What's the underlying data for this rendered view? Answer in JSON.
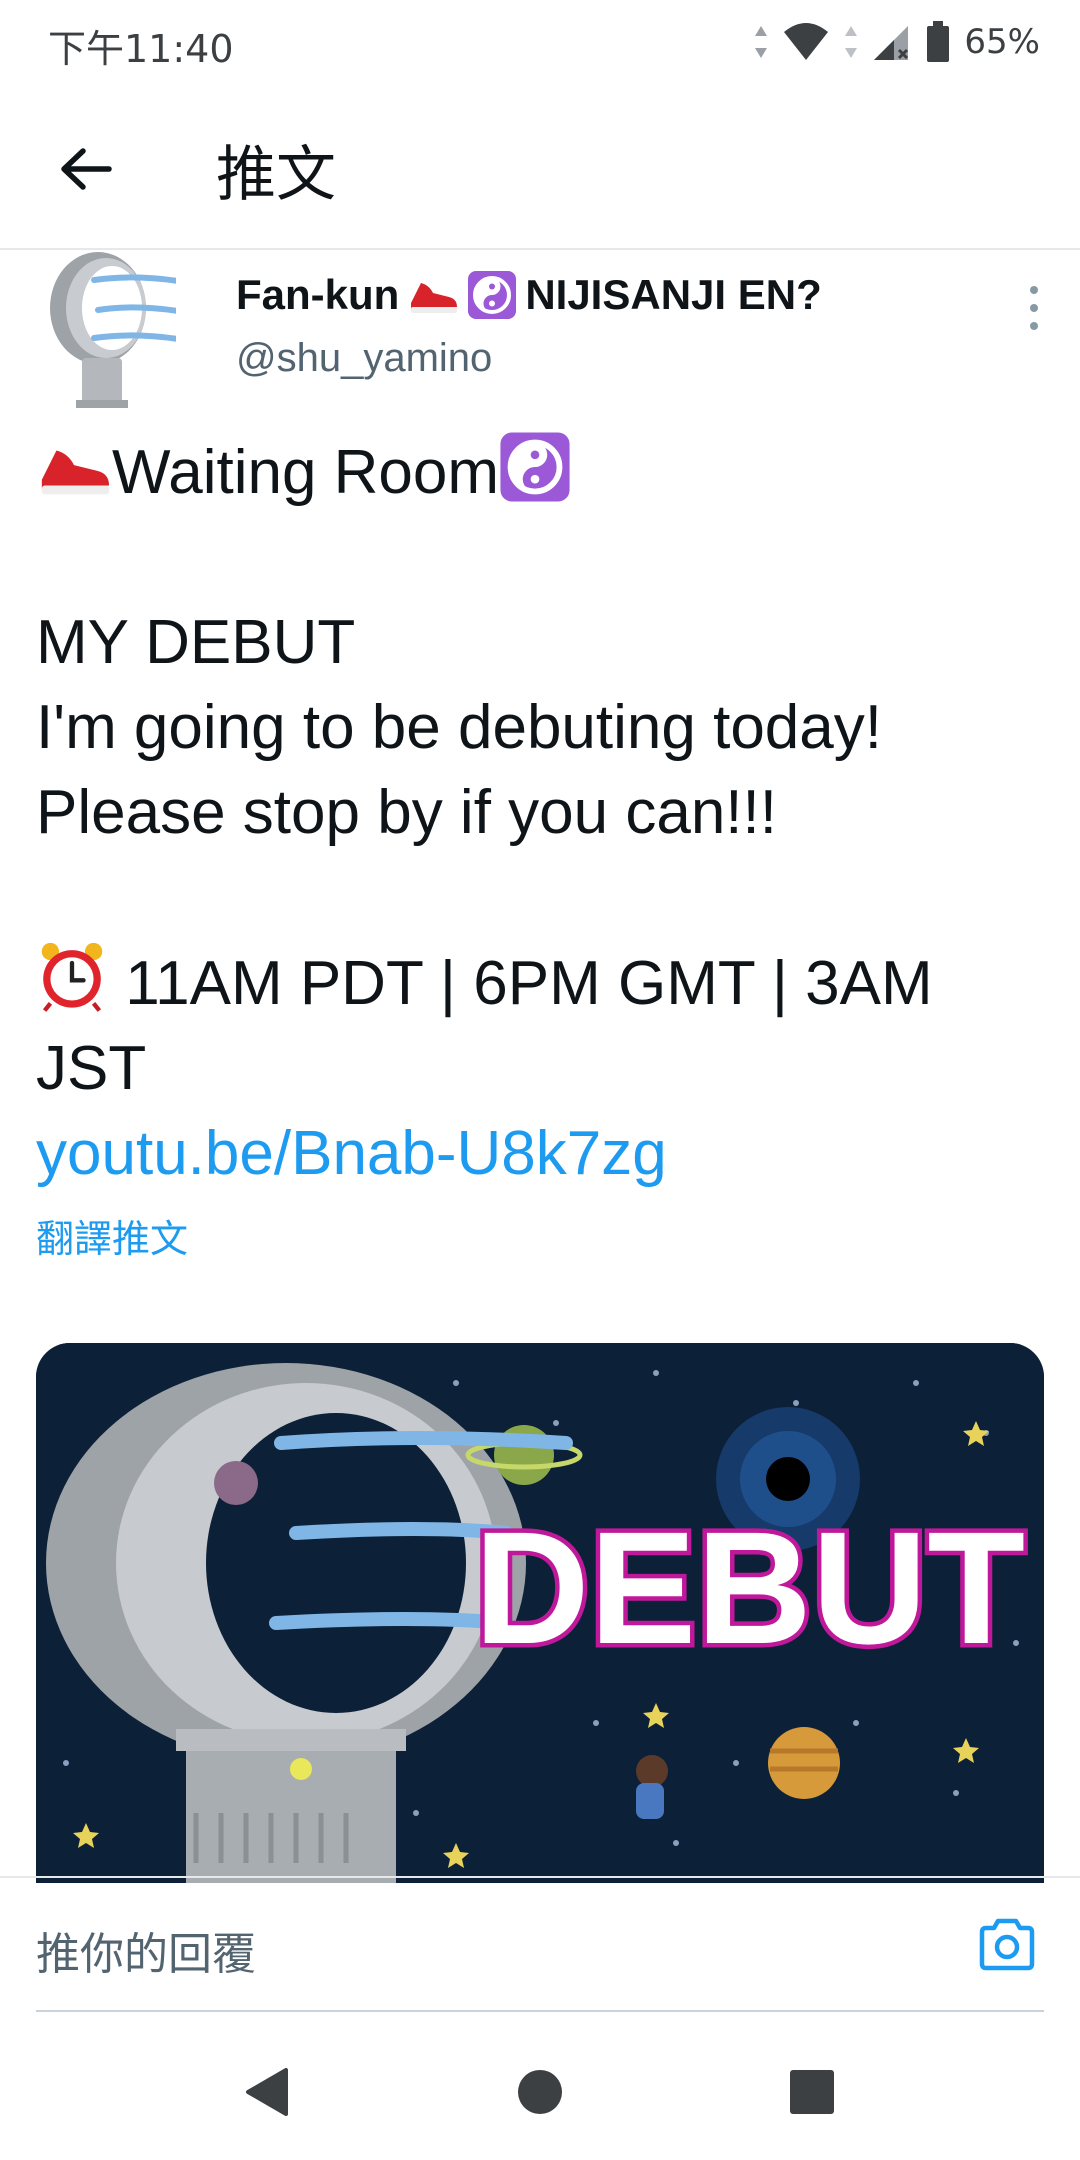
{
  "status_bar": {
    "time": "下午11:40",
    "battery": "65%"
  },
  "header": {
    "title": "推文"
  },
  "tweet": {
    "display_name": "Fan-kun",
    "display_name_suffix": "NIJISANJI EN?",
    "handle": "@shu_yamino",
    "lines": {
      "title": "Waiting Room",
      "debut": "MY DEBUT",
      "today": "I'm going to be debuting today!",
      "stop": "Please stop by if you can!!!",
      "time1": "11AM PDT | 6PM GMT | 3AM",
      "time2": "JST",
      "link": "youtu.be/Bnab-U8k7zg"
    },
    "translate_label": "翻譯推文",
    "media_text": "DEBUT"
  },
  "reply": {
    "placeholder": "推你的回覆"
  },
  "icons": {
    "back": "arrow-left-icon",
    "more": "more-vertical-icon",
    "camera": "camera-icon",
    "sneaker": "sneaker-emoji",
    "yinyang": "yin-yang-emoji",
    "clock": "alarm-clock-emoji"
  },
  "colors": {
    "link": "#1d9bf0",
    "text": "#0f1419",
    "muted": "#536471",
    "emoji_purple": "#9b59d8",
    "media_bg": "#0c2038",
    "debut_outline": "#c0189a"
  }
}
